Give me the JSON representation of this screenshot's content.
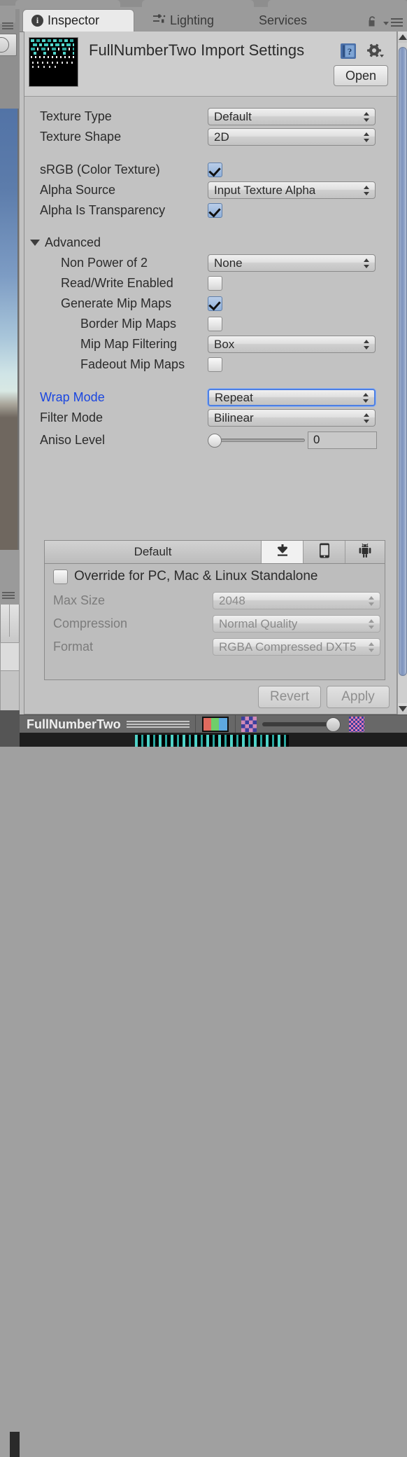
{
  "window": {
    "tabs": [
      {
        "label": "Inspector",
        "icon": "info-icon",
        "active": true
      },
      {
        "label": "Lighting",
        "icon": "lighting-sliders-icon",
        "active": false
      },
      {
        "label": "Services",
        "icon": "",
        "active": false
      }
    ],
    "lock_icon": "lock-open-icon",
    "menu_icon": "hamburger-menu-icon"
  },
  "header": {
    "asset_title": "FullNumberTwo Import Settings",
    "thumbnail": "texture-thumbnail",
    "help_icon": "help-book-icon",
    "gear_icon": "gear-icon",
    "open_label": "Open"
  },
  "properties": [
    {
      "label": "Texture Type",
      "type": "popup",
      "value": "Default"
    },
    {
      "label": "Texture Shape",
      "type": "popup",
      "value": "2D"
    },
    {
      "label": "sRGB (Color Texture)",
      "type": "checkbox",
      "value": "checked"
    },
    {
      "label": "Alpha Source",
      "type": "popup",
      "value": "Input Texture Alpha"
    },
    {
      "label": "Alpha Is Transparency",
      "type": "checkbox",
      "value": "checked"
    }
  ],
  "advanced": {
    "label": "Advanced",
    "expanded": true,
    "rows": [
      {
        "label": "Non Power of 2",
        "type": "popup",
        "value": "None"
      },
      {
        "label": "Read/Write Enabled",
        "type": "checkbox",
        "value": "unchecked"
      },
      {
        "label": "Generate Mip Maps",
        "type": "checkbox",
        "value": "checked"
      },
      {
        "label": "Border Mip Maps",
        "type": "checkbox",
        "value": "unchecked"
      },
      {
        "label": "Mip Map Filtering",
        "type": "popup",
        "value": "Box"
      },
      {
        "label": "Fadeout Mip Maps",
        "type": "checkbox",
        "value": "unchecked"
      }
    ]
  },
  "filtering": {
    "wrap_mode_label": "Wrap Mode",
    "wrap_mode_value": "Repeat",
    "wrap_mode_modified": true,
    "filter_mode_label": "Filter Mode",
    "filter_mode_value": "Bilinear",
    "aniso_label": "Aniso Level",
    "aniso_value": "0",
    "aniso_percent": 0
  },
  "platform": {
    "tabs": [
      {
        "label": "Default",
        "icon": "",
        "selected": false
      },
      {
        "label": "",
        "icon": "standalone-download-icon",
        "selected": true
      },
      {
        "label": "",
        "icon": "ios-phone-icon",
        "selected": false
      },
      {
        "label": "",
        "icon": "android-robot-icon",
        "selected": false
      }
    ],
    "override_label": "Override for PC, Mac & Linux Standalone",
    "override_checked": false,
    "rows": [
      {
        "label": "Max Size",
        "value": "2048"
      },
      {
        "label": "Compression",
        "value": "Normal Quality"
      },
      {
        "label": "Format",
        "value": "RGBA Compressed DXT5"
      }
    ]
  },
  "footer": {
    "revert_label": "Revert",
    "apply_label": "Apply"
  },
  "preview_bar": {
    "asset_name": "FullNumberTwo",
    "rgb_icon": "rgb-channels-icon",
    "mip_low_icon": "mip-level-low-icon",
    "mip_high_icon": "mip-level-high-icon",
    "mip_slider_value": 100
  },
  "colors": {
    "panel_bg": "#c2c2c2",
    "header_bg": "#cdcdcd",
    "tabbar_bg": "#9b9b9b",
    "modified_label": "#1a46e0",
    "focus_outline": "#4d7fe3",
    "checkbox_on": "#8fb0da",
    "scrollbar_thumb": "#7e93bd",
    "preview_bar_bg": "#686868"
  }
}
